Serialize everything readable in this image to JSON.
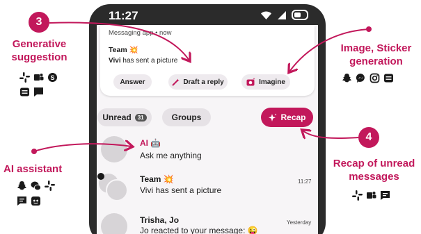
{
  "status_bar": {
    "time": "11:27"
  },
  "notification": {
    "app_line": "Messaging app • now",
    "title": "Team 💥",
    "sender": "Vivi",
    "body": "has sent a picture",
    "actions": [
      "Answer",
      "Draft a reply",
      "Imagine"
    ]
  },
  "filters": {
    "unread_label": "Unread",
    "unread_count": "31",
    "groups_label": "Groups",
    "recap_label": "Recap"
  },
  "chats": [
    {
      "name": "AI 🤖",
      "message": "Ask me anything",
      "time": ""
    },
    {
      "name": "Team 💥",
      "message": "Vivi has sent a picture",
      "time": "11:27"
    },
    {
      "name": "Trisha, Jo",
      "message": "Jo reacted to your message: 😜",
      "time": "Yesterday"
    }
  ],
  "annotations": {
    "generative": {
      "number": "3",
      "title_line1": "Generative",
      "title_line2": "suggestion",
      "icons": [
        "slack-icon",
        "teams-icon",
        "skype-icon",
        "messages-icon",
        "chat-icon"
      ]
    },
    "image_sticker": {
      "title_line1": "Image, Sticker",
      "title_line2": "generation",
      "icons": [
        "snapchat-icon",
        "messenger-icon",
        "instagram-icon",
        "messages-icon"
      ]
    },
    "ai_assistant": {
      "title": "AI assistant",
      "icons": [
        "snapchat-icon",
        "wechat-icon",
        "slack-icon",
        "chat-icon",
        "discord-icon"
      ]
    },
    "recap": {
      "number": "4",
      "title_line1": "Recap of unread",
      "title_line2": "messages",
      "icons": [
        "slack-icon",
        "teams-icon",
        "chat-icon"
      ]
    }
  },
  "colors": {
    "accent": "#c2185b",
    "phone": "#2b2b2b",
    "screen": "#f7f5f7"
  }
}
